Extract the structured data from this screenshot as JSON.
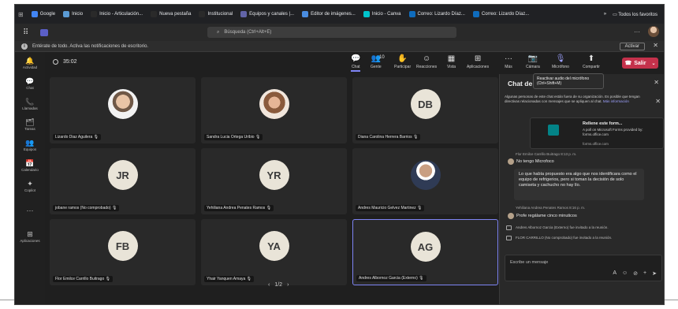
{
  "bookmarks": [
    "Google",
    "Inicio",
    "Inicio - Articulación...",
    "Nueva pestaña",
    "Institucional",
    "Equipos y canales |...",
    "Editor de imágenes...",
    "Inicio - Canva",
    "Correo: Lizardo Díaz...",
    "Correo: Lizardo Díaz..."
  ],
  "bookmarks_right": {
    "more": "»",
    "all": "Todos los favoritos"
  },
  "titlebar": {
    "search_placeholder": "Búsqueda (Ctrl+Alt+E)",
    "more": "···"
  },
  "notification": {
    "text": "Entérate de todo. Activa las notificaciones de escritorio.",
    "button": "Activar",
    "close": "✕"
  },
  "rail": [
    {
      "icon": "🔔",
      "label": "Actividad"
    },
    {
      "icon": "💬",
      "label": "Chat"
    },
    {
      "icon": "📞",
      "label": "Llamadas"
    },
    {
      "icon": "🗂",
      "label": "Tareas"
    },
    {
      "icon": "👥",
      "label": "Equipos"
    },
    {
      "icon": "📅",
      "label": "Calendario"
    },
    {
      "icon": "✦",
      "label": "Copilot"
    },
    {
      "icon": "···",
      "label": ""
    },
    {
      "icon": "⊞",
      "label": "Aplicaciones"
    }
  ],
  "meeting": {
    "timer": "35:02",
    "toolbar": [
      {
        "icon": "💬",
        "label": "Chat"
      },
      {
        "icon": "👥",
        "label": "Gente"
      },
      {
        "icon": "✋",
        "label": "Participar"
      },
      {
        "icon": "☺",
        "label": "Reacciones"
      },
      {
        "icon": "▦",
        "label": "Vista"
      },
      {
        "icon": "⊞",
        "label": "Aplicaciones"
      },
      {
        "icon": "···",
        "label": "Más"
      },
      {
        "icon": "📷",
        "label": "Cámara"
      },
      {
        "icon": "🎙",
        "label": "Micrófono"
      },
      {
        "icon": "⬆",
        "label": "Compartir"
      }
    ],
    "participant_count": "10",
    "leave_label": "Salir",
    "mic_tooltip": "Reactivar audio del micrófono (Ctrl+Shift+M)"
  },
  "participants": [
    {
      "name": "Lizardo Diaz Aguilera",
      "initials": "",
      "photo": "photo1",
      "selected": false
    },
    {
      "name": "Sandra Lucia Ortega Uribio",
      "initials": "",
      "photo": "photo2",
      "selected": false
    },
    {
      "name": "Diana Carolina Herrera Barrios",
      "initials": "DB",
      "photo": "",
      "selected": false
    },
    {
      "name": "jobane ramos (No comprobado)",
      "initials": "JR",
      "photo": "",
      "selected": false
    },
    {
      "name": "Yehiliana Andrea Penates Ramos",
      "initials": "YR",
      "photo": "",
      "selected": false
    },
    {
      "name": "Andres Mauricio Gelvez Martinez",
      "initials": "",
      "photo": "photo3",
      "selected": false
    },
    {
      "name": "Flor Emilce Carrillo Buitrago",
      "initials": "FB",
      "photo": "",
      "selected": false
    },
    {
      "name": "Yhair Yanquen Amaya",
      "initials": "YA",
      "photo": "",
      "selected": false
    },
    {
      "name": "Andres Albornoz Garcia (Externo)",
      "initials": "AG",
      "photo": "",
      "selected": true
    }
  ],
  "pager": {
    "prev": "‹",
    "page": "1/2",
    "next": "›"
  },
  "chat": {
    "title": "Chat de reunió",
    "close": "✕",
    "warning": "Algunas personas de este chat están fuera de su organización. Es posible que tengan directivas relacionadas con mensajes que se apliquen al chat.",
    "warning_link": "Más información",
    "forms_card": {
      "title": "Rellene este form...",
      "desc": "A poll on Microsoft Forms provided by: forms.office.com",
      "domain": "forms.office.com"
    },
    "msg1_meta": "Flor Emilce Carrillo Buitrago   8:13 p. m.",
    "msg1_text": "No tengo Microfoco",
    "msg2_text": "Lo que había propuesto era algo que nos identificara como el equipo de refrigerios, pero si toman la decisión de solo camiseta y cachucho no hay lío.",
    "msg3_meta": "Yehiliana Andrea Penates Ramos   8:16 p. m.",
    "msg3_text": "Profe regálame cinco minuticos",
    "sys1": "Andres Albornoz Garcia (Externo) fue invitado a la reunión.",
    "sys2": "FLOR CARRILLO (No comprobado) fue invitado a la reunión.",
    "compose_placeholder": "Escribe un mensaje"
  }
}
